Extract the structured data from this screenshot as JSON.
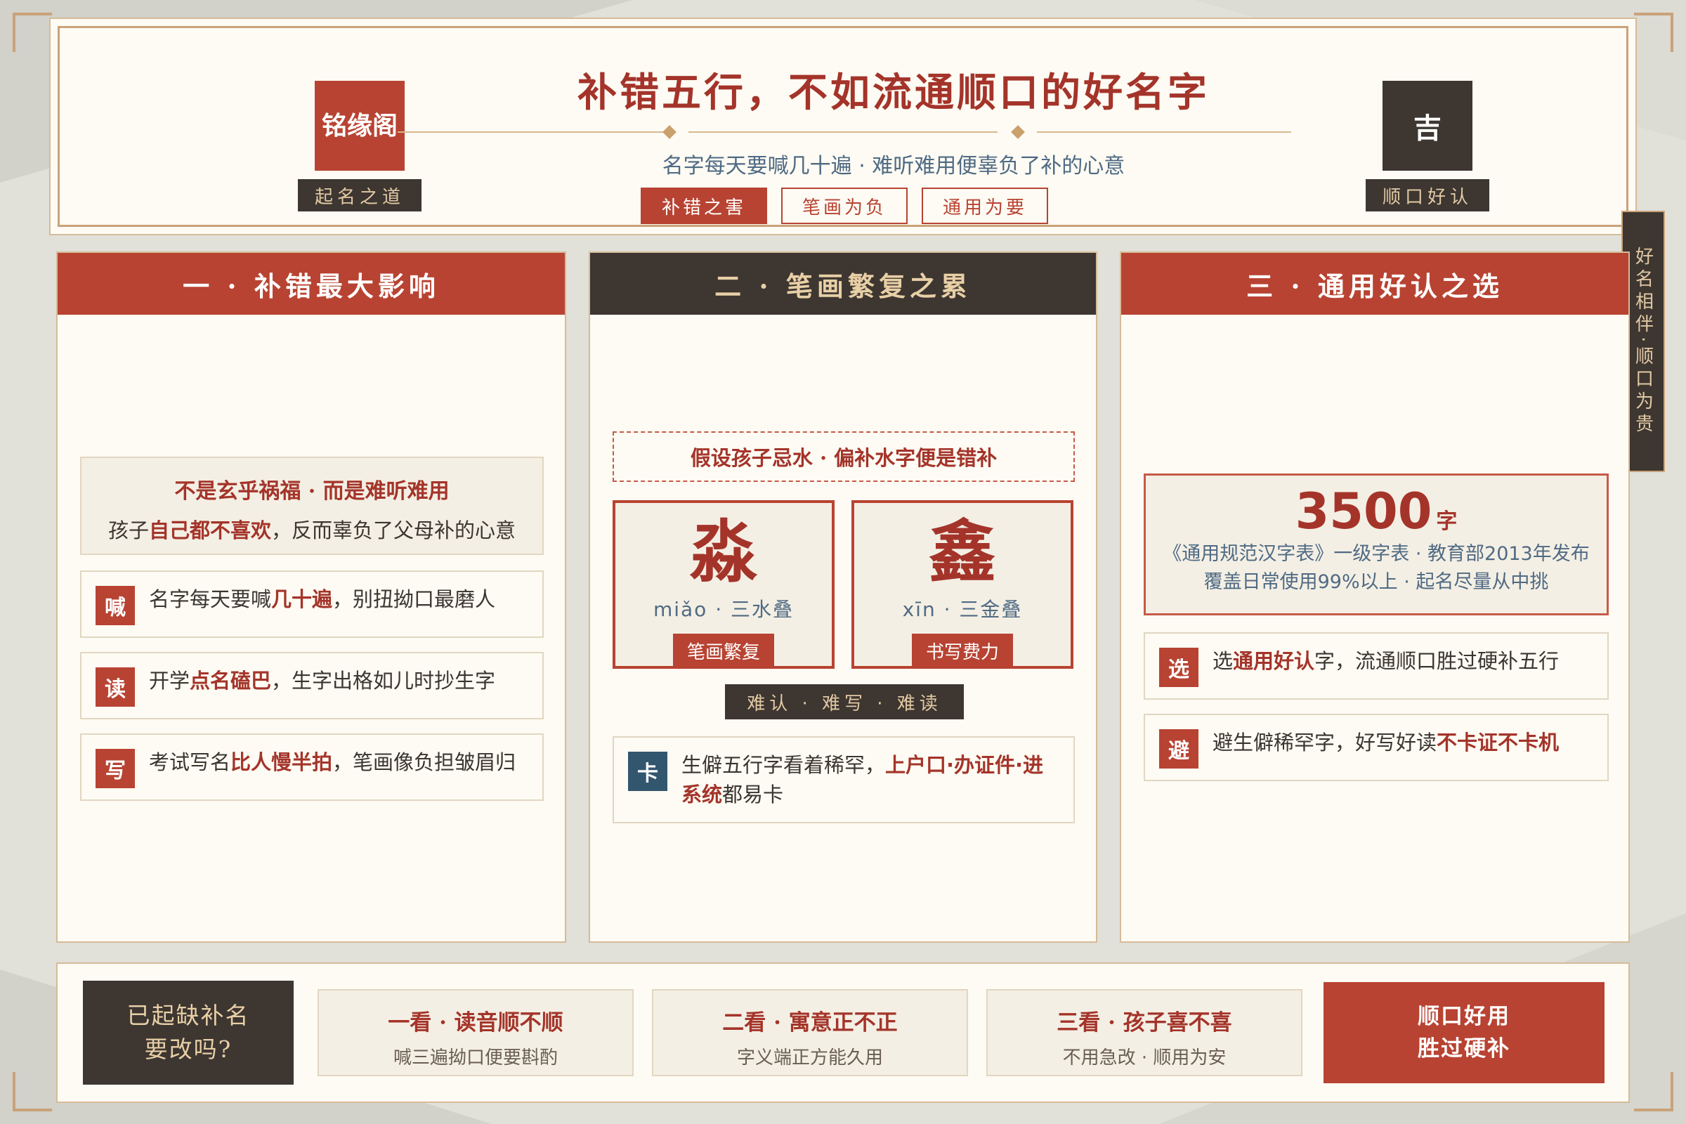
{
  "header": {
    "title": "补错五行，不如流通顺口的好名字",
    "subtitle": "名字每天要喊几十遍 · 难听难用便辜负了补的心意",
    "seal_left": "铭缘阁",
    "seal_left_tag": "起名之道",
    "seal_right": "吉",
    "seal_right_tag": "顺口好认",
    "pills": [
      "补错之害",
      "笔画为负",
      "通用为要"
    ]
  },
  "side_tab": "好名相伴·顺口为贵",
  "columns": {
    "one": {
      "title": "一 · 补错最大影响",
      "note_title": "不是玄乎祸福 · 而是难听难用",
      "note_pre": "孩子",
      "note_hl": "自己都不喜欢",
      "note_post": "，反而辜负了父母补的心意",
      "items": [
        {
          "icon": "喊",
          "pre": "名字每天要喊",
          "hl": "几十遍",
          "post": "，别扭拗口最磨人"
        },
        {
          "icon": "读",
          "pre": "开学",
          "hl": "点名磕巴",
          "post": "，生字出格如儿时抄生字"
        },
        {
          "icon": "写",
          "pre": "考试写名",
          "hl": "比人慢半拍",
          "post": "，笔画像负担皱眉归"
        }
      ]
    },
    "two": {
      "title": "二 · 笔画繁复之累",
      "premise": "假设孩子忌水 · 偏补水字便是错补",
      "chars": [
        {
          "glyph": "淼",
          "pinyin": "miǎo · 三水叠",
          "label": "笔画繁复"
        },
        {
          "glyph": "鑫",
          "pinyin": "xīn · 三金叠",
          "label": "书写费力"
        }
      ],
      "strip": "难认 · 难写 · 难读",
      "card": {
        "icon": "卡",
        "pre": "生僻五行字看着稀罕，",
        "hl": "上户口·办证件·进系统",
        "post": "都易卡"
      }
    },
    "three": {
      "title": "三 · 通用好认之选",
      "big_number": "3500",
      "big_unit": "字",
      "big_line1": "《通用规范汉字表》一级字表 · 教育部2013年发布",
      "big_line2": "覆盖日常使用99%以上 · 起名尽量从中挑",
      "items": [
        {
          "icon": "选",
          "pre": "选",
          "hl": "通用好认",
          "post": "字，流通顺口胜过硬补五行"
        },
        {
          "icon": "避",
          "pre": "避生僻稀罕字，好写好读",
          "hl": "不卡证不卡机",
          "post": ""
        }
      ]
    }
  },
  "footer": {
    "question_line1": "已起缺补名",
    "question_line2": "要改吗?",
    "cards": [
      {
        "title": "一看 · 读音顺不顺",
        "sub": "喊三遍拗口便要斟酌"
      },
      {
        "title": "二看 · 寓意正不正",
        "sub": "字义端正方能久用"
      },
      {
        "title": "三看 · 孩子喜不喜",
        "sub": "不用急改 · 顺用为安"
      }
    ],
    "cta_line1": "顺口好用",
    "cta_line2": "胜过硬补"
  },
  "colors": {
    "accent_red": "#b84332",
    "dark": "#3d3631",
    "gold": "#c9a27a",
    "paper": "#fdfbf3",
    "blue_text": "#4f6a84"
  }
}
